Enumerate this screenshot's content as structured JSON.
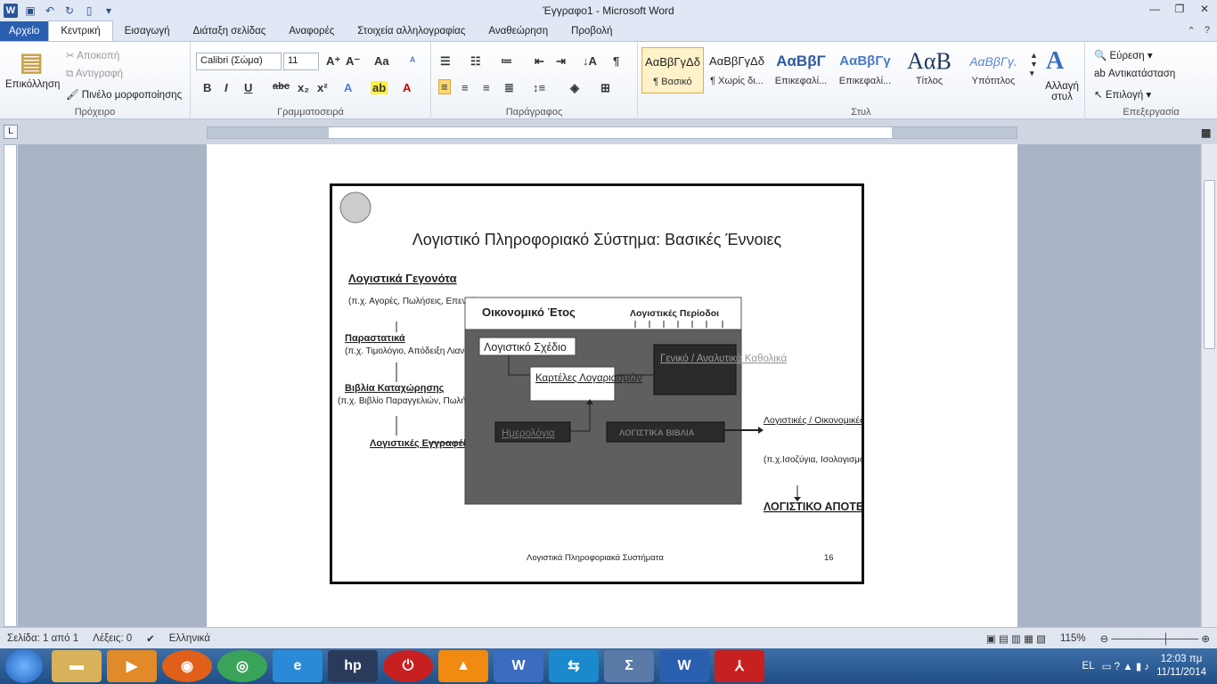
{
  "window": {
    "title": "Έγγραφο1 - Microsoft Word",
    "app_letter": "W"
  },
  "tabs": [
    {
      "label": "Αρχείο"
    },
    {
      "label": "Κεντρική"
    },
    {
      "label": "Εισαγωγή"
    },
    {
      "label": "Διάταξη σελίδας"
    },
    {
      "label": "Αναφορές"
    },
    {
      "label": "Στοιχεία αλληλογραφίας"
    },
    {
      "label": "Αναθεώρηση"
    },
    {
      "label": "Προβολή"
    }
  ],
  "clipboard": {
    "paste": "Επικόλληση",
    "cut": "Αποκοπή",
    "copy": "Αντιγραφή",
    "format_painter": "Πινέλο μορφοποίησης",
    "label": "Πρόχειρο"
  },
  "font": {
    "name": "Calibri (Σώμα)",
    "size": "11",
    "label": "Γραμματοσειρά"
  },
  "paragraph": {
    "label": "Παράγραφος"
  },
  "styles": {
    "label": "Στυλ",
    "items": [
      {
        "preview": "ΑαΒβΓγΔδ",
        "name": "¶ Βασικό"
      },
      {
        "preview": "ΑαΒβΓγΔδ",
        "name": "¶ Χωρίς δι..."
      },
      {
        "preview": "ΑαΒβΓ",
        "name": "Επικεφαλί..."
      },
      {
        "preview": "ΑαΒβΓγ",
        "name": "Επικεφαλί..."
      },
      {
        "preview": "ΑαΒ",
        "name": "Τίτλος"
      },
      {
        "preview": "ΑαΒβΓγ.",
        "name": "Υπότιτλος"
      }
    ],
    "change": "Αλλαγή στυλ"
  },
  "editing": {
    "find": "Εύρεση",
    "replace": "Αντικατάσταση",
    "select": "Επιλογή",
    "label": "Επεξεργασία"
  },
  "slide": {
    "title": "Λογιστικό Πληροφοριακό Σύστημα: Βασικές Έννοιες",
    "left1_title": "Λογιστικά Γεγονότα",
    "left1_rest": "(π.χ. Αγορές, Πωλήσεις, Επενδύσεις κλπ)",
    "left2_title": "Παραστατικά",
    "left2_rest": "(π.χ. Τιμολόγιο, Απόδειξη Λιανικής κλπ)",
    "left3_title": "Βιβλία Καταχώρησης",
    "left3_rest": "(π.χ. Βιβλίο Παραγγελιών, Πωλήσεων κλπ)",
    "left4_title": "Λογιστικές Εγγραφές",
    "fiscal_year": "Οικονομικό Έτος",
    "periods": "Λογιστικές Περίοδοι",
    "chart_accounts": "Λογιστικό Σχέδιο",
    "cards": "Καρτέλες Λογαριασμών",
    "ledgers": "Γενικό / Αναλυτικά Καθολικά",
    "journal": "Ημερολόγια",
    "books": "ΛΟΓΙΣΤΙΚΑ ΒΙΒΛΙΑ",
    "right_title": "Λογιστικές / Οικονομικές Καταστάσεις",
    "right_rest": "(π.χ.Ισοζύγια, Ισολογισμός, Κ.Α.Χ.)",
    "result": "ΛΟΓΙΣΤΙΚΟ ΑΠΟΤΕΛΕΣΜΑ",
    "footer": "Λογιστικά Πληροφοριακά Συστήματα",
    "page_no": "16"
  },
  "status": {
    "page": "Σελίδα: 1 από 1",
    "words": "Λέξεις: 0",
    "lang": "Ελληνικά",
    "zoom": "115%"
  },
  "tray": {
    "lang": "EL",
    "time": "12:03 πμ",
    "date": "11/11/2014"
  }
}
